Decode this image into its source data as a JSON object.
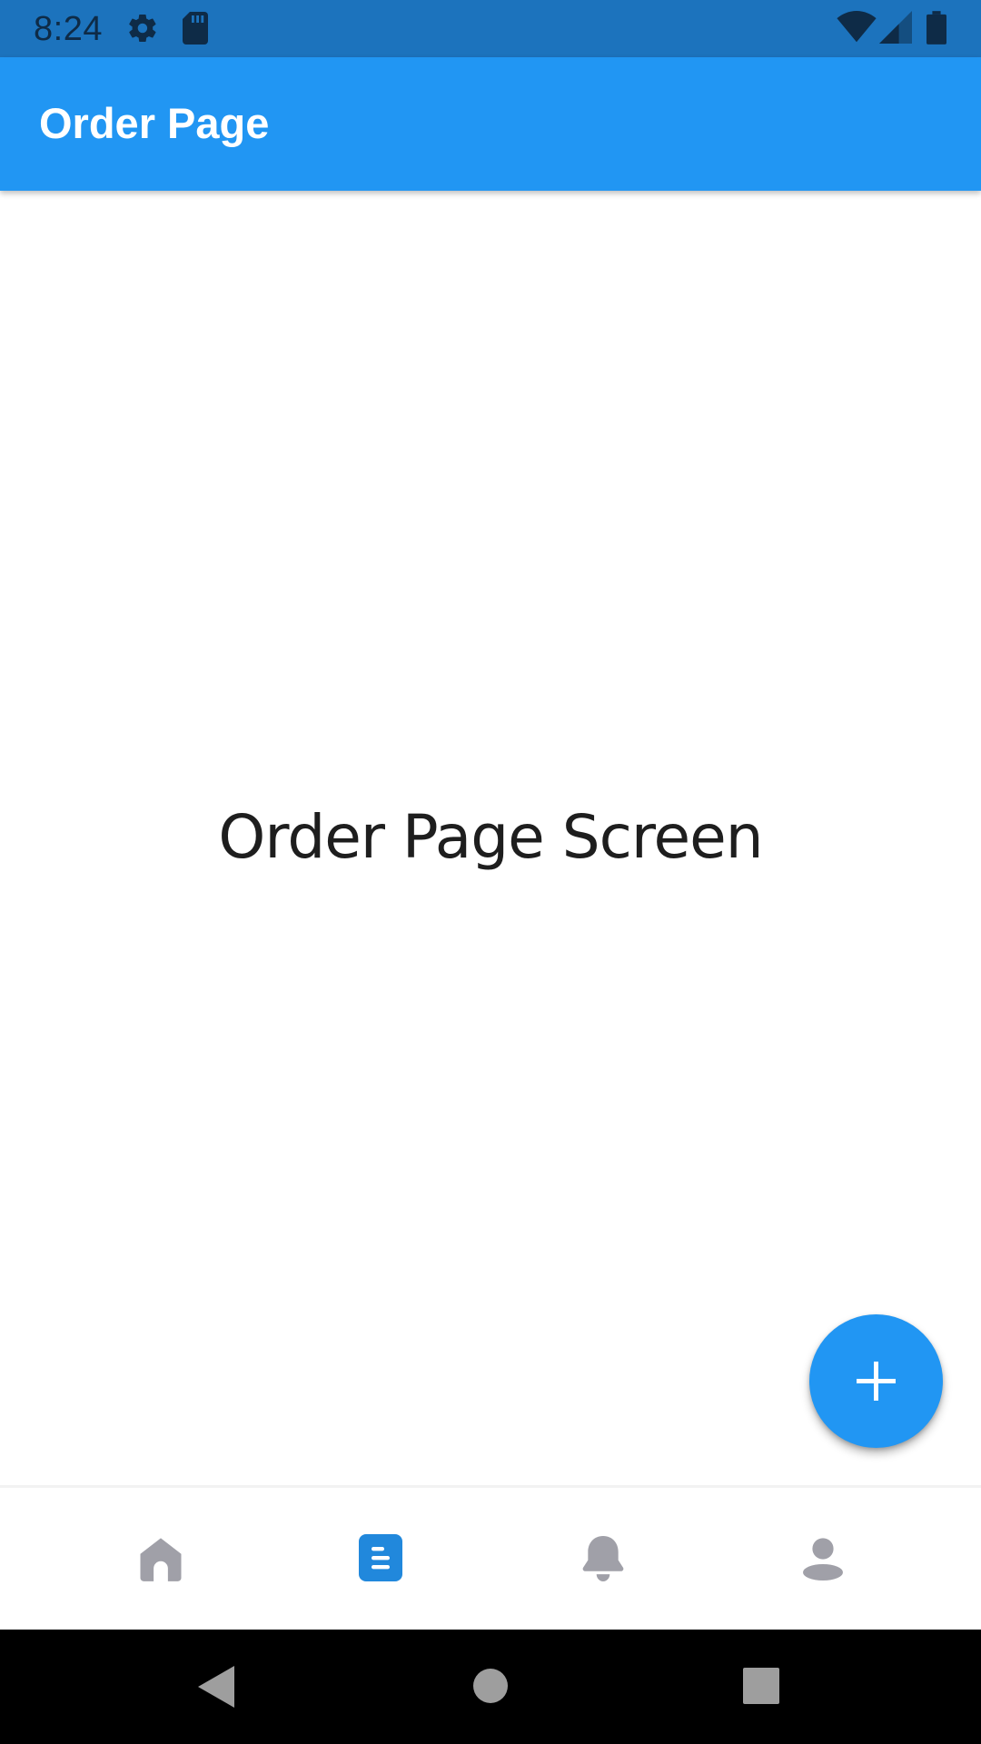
{
  "status_bar": {
    "time": "8:24",
    "icons": [
      "gear-icon",
      "sd-card-icon",
      "wifi-icon",
      "signal-icon",
      "battery-icon"
    ]
  },
  "app_bar": {
    "title": "Order Page",
    "color": "#2196f3"
  },
  "main": {
    "label": "Order Page Screen"
  },
  "fab": {
    "icon": "plus-icon",
    "color": "#2196f3"
  },
  "bottom_nav": {
    "items": [
      {
        "icon": "home-icon",
        "active": false
      },
      {
        "icon": "order-list-icon",
        "active": true
      },
      {
        "icon": "bell-icon",
        "active": false
      },
      {
        "icon": "person-icon",
        "active": false
      }
    ],
    "active_color": "#2188dc",
    "inactive_color": "#a0a0a8"
  },
  "system_nav": {
    "icons": [
      "back-icon",
      "home-circle-icon",
      "recents-icon"
    ]
  }
}
